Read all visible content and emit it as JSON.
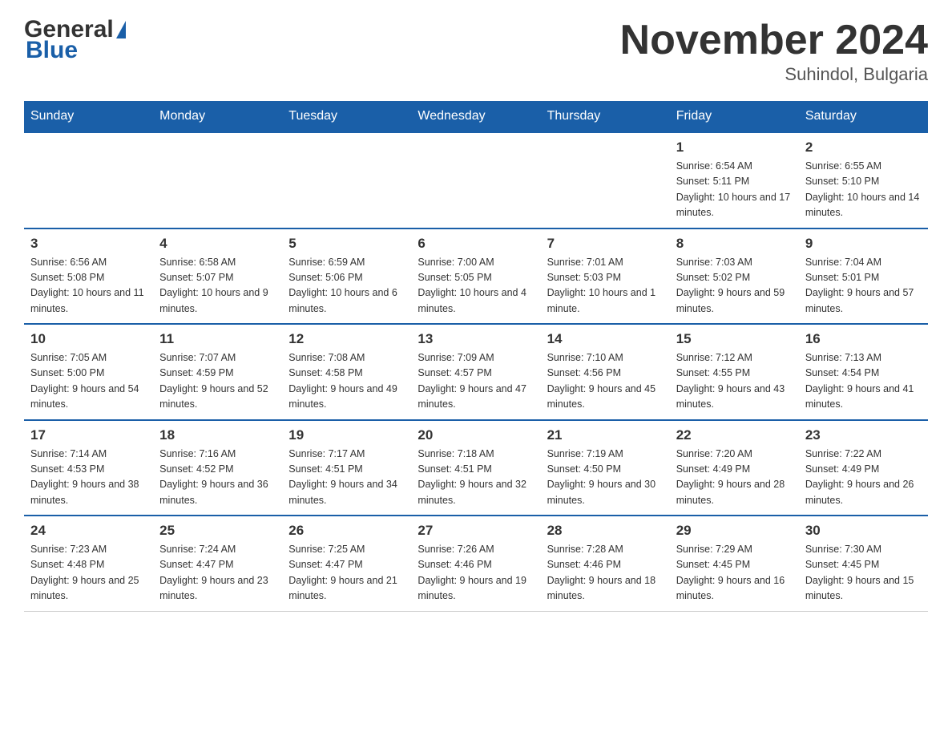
{
  "header": {
    "logo_general": "General",
    "logo_blue": "Blue",
    "month_title": "November 2024",
    "location": "Suhindol, Bulgaria"
  },
  "days_of_week": [
    "Sunday",
    "Monday",
    "Tuesday",
    "Wednesday",
    "Thursday",
    "Friday",
    "Saturday"
  ],
  "weeks": [
    [
      {
        "day": "",
        "sunrise": "",
        "sunset": "",
        "daylight": ""
      },
      {
        "day": "",
        "sunrise": "",
        "sunset": "",
        "daylight": ""
      },
      {
        "day": "",
        "sunrise": "",
        "sunset": "",
        "daylight": ""
      },
      {
        "day": "",
        "sunrise": "",
        "sunset": "",
        "daylight": ""
      },
      {
        "day": "",
        "sunrise": "",
        "sunset": "",
        "daylight": ""
      },
      {
        "day": "1",
        "sunrise": "Sunrise: 6:54 AM",
        "sunset": "Sunset: 5:11 PM",
        "daylight": "Daylight: 10 hours and 17 minutes."
      },
      {
        "day": "2",
        "sunrise": "Sunrise: 6:55 AM",
        "sunset": "Sunset: 5:10 PM",
        "daylight": "Daylight: 10 hours and 14 minutes."
      }
    ],
    [
      {
        "day": "3",
        "sunrise": "Sunrise: 6:56 AM",
        "sunset": "Sunset: 5:08 PM",
        "daylight": "Daylight: 10 hours and 11 minutes."
      },
      {
        "day": "4",
        "sunrise": "Sunrise: 6:58 AM",
        "sunset": "Sunset: 5:07 PM",
        "daylight": "Daylight: 10 hours and 9 minutes."
      },
      {
        "day": "5",
        "sunrise": "Sunrise: 6:59 AM",
        "sunset": "Sunset: 5:06 PM",
        "daylight": "Daylight: 10 hours and 6 minutes."
      },
      {
        "day": "6",
        "sunrise": "Sunrise: 7:00 AM",
        "sunset": "Sunset: 5:05 PM",
        "daylight": "Daylight: 10 hours and 4 minutes."
      },
      {
        "day": "7",
        "sunrise": "Sunrise: 7:01 AM",
        "sunset": "Sunset: 5:03 PM",
        "daylight": "Daylight: 10 hours and 1 minute."
      },
      {
        "day": "8",
        "sunrise": "Sunrise: 7:03 AM",
        "sunset": "Sunset: 5:02 PM",
        "daylight": "Daylight: 9 hours and 59 minutes."
      },
      {
        "day": "9",
        "sunrise": "Sunrise: 7:04 AM",
        "sunset": "Sunset: 5:01 PM",
        "daylight": "Daylight: 9 hours and 57 minutes."
      }
    ],
    [
      {
        "day": "10",
        "sunrise": "Sunrise: 7:05 AM",
        "sunset": "Sunset: 5:00 PM",
        "daylight": "Daylight: 9 hours and 54 minutes."
      },
      {
        "day": "11",
        "sunrise": "Sunrise: 7:07 AM",
        "sunset": "Sunset: 4:59 PM",
        "daylight": "Daylight: 9 hours and 52 minutes."
      },
      {
        "day": "12",
        "sunrise": "Sunrise: 7:08 AM",
        "sunset": "Sunset: 4:58 PM",
        "daylight": "Daylight: 9 hours and 49 minutes."
      },
      {
        "day": "13",
        "sunrise": "Sunrise: 7:09 AM",
        "sunset": "Sunset: 4:57 PM",
        "daylight": "Daylight: 9 hours and 47 minutes."
      },
      {
        "day": "14",
        "sunrise": "Sunrise: 7:10 AM",
        "sunset": "Sunset: 4:56 PM",
        "daylight": "Daylight: 9 hours and 45 minutes."
      },
      {
        "day": "15",
        "sunrise": "Sunrise: 7:12 AM",
        "sunset": "Sunset: 4:55 PM",
        "daylight": "Daylight: 9 hours and 43 minutes."
      },
      {
        "day": "16",
        "sunrise": "Sunrise: 7:13 AM",
        "sunset": "Sunset: 4:54 PM",
        "daylight": "Daylight: 9 hours and 41 minutes."
      }
    ],
    [
      {
        "day": "17",
        "sunrise": "Sunrise: 7:14 AM",
        "sunset": "Sunset: 4:53 PM",
        "daylight": "Daylight: 9 hours and 38 minutes."
      },
      {
        "day": "18",
        "sunrise": "Sunrise: 7:16 AM",
        "sunset": "Sunset: 4:52 PM",
        "daylight": "Daylight: 9 hours and 36 minutes."
      },
      {
        "day": "19",
        "sunrise": "Sunrise: 7:17 AM",
        "sunset": "Sunset: 4:51 PM",
        "daylight": "Daylight: 9 hours and 34 minutes."
      },
      {
        "day": "20",
        "sunrise": "Sunrise: 7:18 AM",
        "sunset": "Sunset: 4:51 PM",
        "daylight": "Daylight: 9 hours and 32 minutes."
      },
      {
        "day": "21",
        "sunrise": "Sunrise: 7:19 AM",
        "sunset": "Sunset: 4:50 PM",
        "daylight": "Daylight: 9 hours and 30 minutes."
      },
      {
        "day": "22",
        "sunrise": "Sunrise: 7:20 AM",
        "sunset": "Sunset: 4:49 PM",
        "daylight": "Daylight: 9 hours and 28 minutes."
      },
      {
        "day": "23",
        "sunrise": "Sunrise: 7:22 AM",
        "sunset": "Sunset: 4:49 PM",
        "daylight": "Daylight: 9 hours and 26 minutes."
      }
    ],
    [
      {
        "day": "24",
        "sunrise": "Sunrise: 7:23 AM",
        "sunset": "Sunset: 4:48 PM",
        "daylight": "Daylight: 9 hours and 25 minutes."
      },
      {
        "day": "25",
        "sunrise": "Sunrise: 7:24 AM",
        "sunset": "Sunset: 4:47 PM",
        "daylight": "Daylight: 9 hours and 23 minutes."
      },
      {
        "day": "26",
        "sunrise": "Sunrise: 7:25 AM",
        "sunset": "Sunset: 4:47 PM",
        "daylight": "Daylight: 9 hours and 21 minutes."
      },
      {
        "day": "27",
        "sunrise": "Sunrise: 7:26 AM",
        "sunset": "Sunset: 4:46 PM",
        "daylight": "Daylight: 9 hours and 19 minutes."
      },
      {
        "day": "28",
        "sunrise": "Sunrise: 7:28 AM",
        "sunset": "Sunset: 4:46 PM",
        "daylight": "Daylight: 9 hours and 18 minutes."
      },
      {
        "day": "29",
        "sunrise": "Sunrise: 7:29 AM",
        "sunset": "Sunset: 4:45 PM",
        "daylight": "Daylight: 9 hours and 16 minutes."
      },
      {
        "day": "30",
        "sunrise": "Sunrise: 7:30 AM",
        "sunset": "Sunset: 4:45 PM",
        "daylight": "Daylight: 9 hours and 15 minutes."
      }
    ]
  ]
}
